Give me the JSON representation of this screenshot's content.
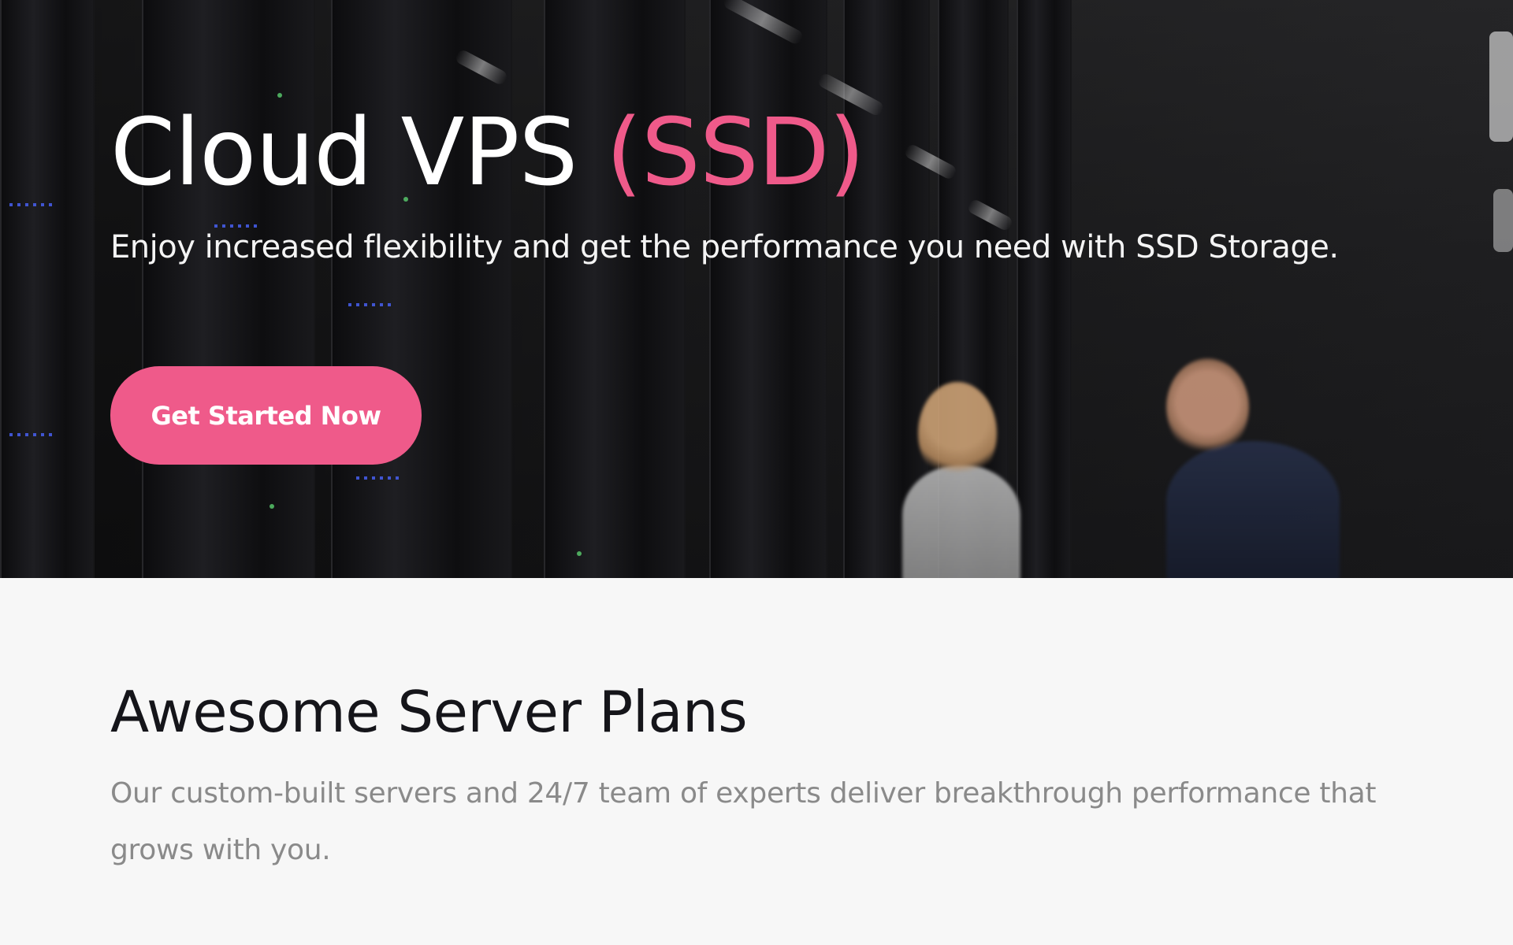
{
  "hero": {
    "title_main": "Cloud VPS",
    "title_accent": "(SSD)",
    "subtitle": "Enjoy increased flexibility and get the performance you need with SSD Storage.",
    "cta_label": "Get Started Now"
  },
  "plans": {
    "title": "Awesome Server Plans",
    "description": "Our custom-built servers and 24/7 team of experts deliver breakthrough performance that grows with you."
  },
  "colors": {
    "accent": "#ef5a8a",
    "heading": "#15151a",
    "muted_text": "#8a8a8a",
    "section_bg": "#f7f7f7"
  }
}
